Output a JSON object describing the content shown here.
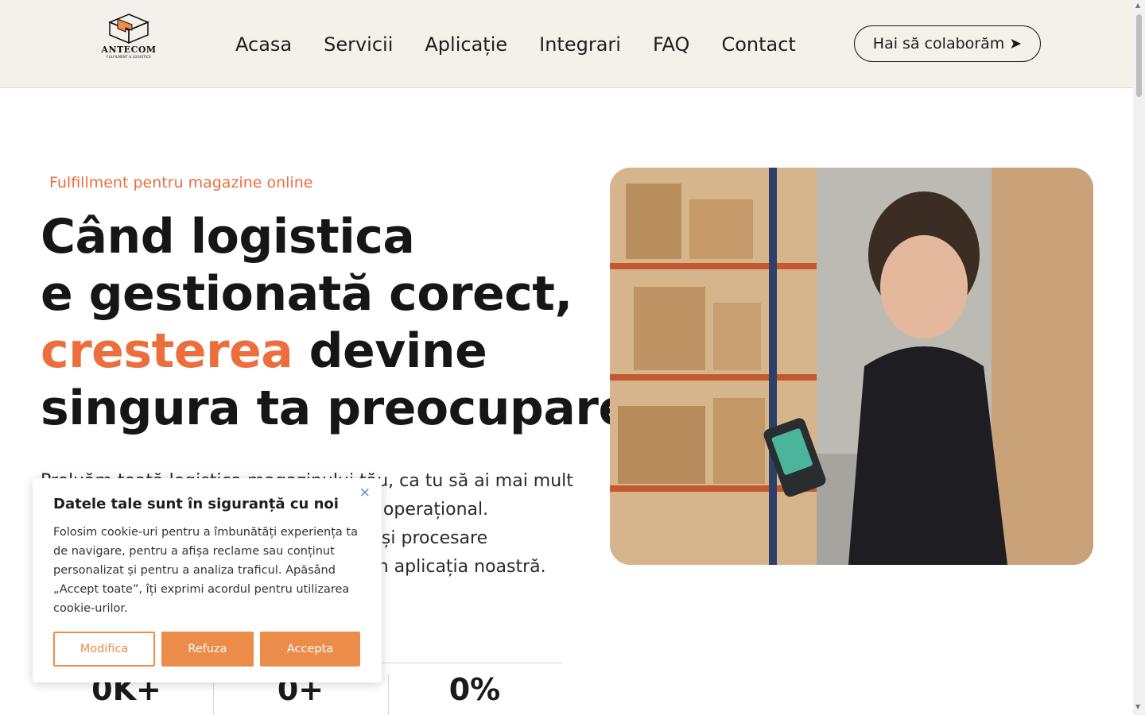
{
  "header": {
    "logo": {
      "name": "ANTECOM",
      "tagline": "FULFILMENT & LOGISTICS"
    },
    "nav": [
      "Acasa",
      "Servicii",
      "Aplicație",
      "Integrari",
      "FAQ",
      "Contact"
    ],
    "cta_label": "Hai să colaborăm ➤"
  },
  "hero": {
    "eyebrow": "Fulfillment pentru magazine online",
    "title_line1": "Când logistica",
    "title_line2": "e gestionată corect,",
    "title_accent": "cresterea",
    "title_line3_rest": " devine",
    "title_line4": "singura ta preocupare",
    "body_line1": "Preluăm toată logistica magazinului tău, ca tu să ai mai mult",
    "body_line2": "timp pentru creștere și mai puțin stres operațional.",
    "body_line3": "Stocare, ambalare, expediere, retururi și procesare",
    "body_line4": "comenzi, toate gestionate automat prin aplicația noastră."
  },
  "stats": [
    "0K+",
    "0+",
    "0%"
  ],
  "cookie_banner": {
    "title": "Datele tale sunt în siguranță cu noi",
    "close_glyph": "×",
    "text_line1": "Folosim cookie-uri pentru a îmbunătăți experiența ta",
    "text_line2": "de navigare, pentru a afișa reclame sau conținut",
    "text_line3": "personalizat și pentru a analiza traficul. Apăsând",
    "text_line4": "„Accept toate”, îți exprimi acordul pentru utilizarea",
    "text_line5": "cookie-urilor.",
    "buttons": {
      "modify": "Modifica",
      "refuse": "Refuza",
      "accept": "Accepta"
    }
  },
  "colors": {
    "accent": "#ec6e3c",
    "cookie_button": "#ec8c4a",
    "header_bg": "#f4f0ea"
  },
  "icons": {
    "cookie_close": "close-icon",
    "logo": "box-icon"
  }
}
